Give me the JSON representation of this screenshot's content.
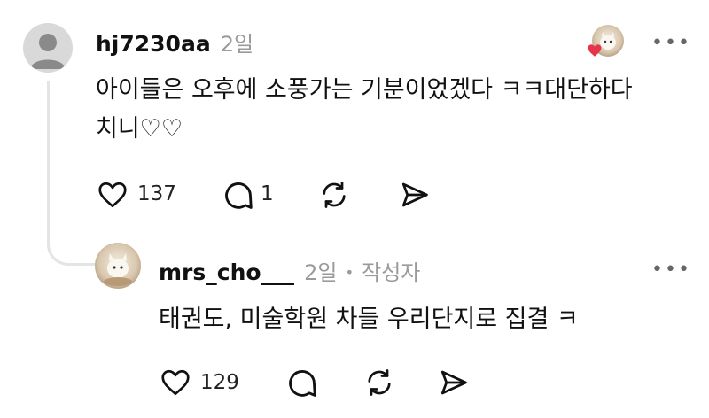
{
  "colors": {
    "like_dot": "#e8344a",
    "muted": "#9a9a9a",
    "text": "#111111"
  },
  "comment": {
    "username": "hj7230aa",
    "time": "2일",
    "text": "아이들은 오후에 소풍가는 기분이었겠다 ㅋㅋ대단하다\n치니♡♡",
    "likes": "137",
    "replies": "1",
    "more": "•••",
    "icons": [
      "heart-icon",
      "comment-icon",
      "repost-icon",
      "share-icon"
    ]
  },
  "reply": {
    "username": "mrs_cho___",
    "time": "2일",
    "separator": "•",
    "author_badge": "작성자",
    "text": "태권도, 미술학원 차들 우리단지로 집결 ㅋ",
    "likes": "129",
    "more": "•••",
    "icons": [
      "heart-icon",
      "comment-icon",
      "repost-icon",
      "share-icon"
    ]
  }
}
